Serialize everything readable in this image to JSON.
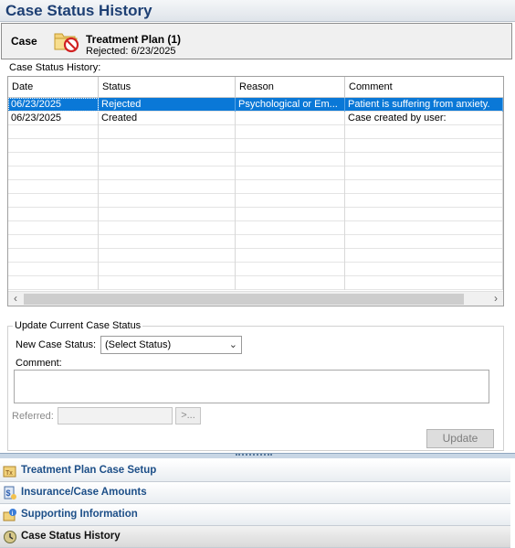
{
  "header": {
    "title": "Case Status History"
  },
  "case": {
    "label": "Case",
    "icon": "folder-rejected-icon",
    "plan_name": "Treatment Plan (1)",
    "plan_status": "Rejected: 6/23/2025"
  },
  "history": {
    "label": "Case Status History:",
    "columns": [
      "Date",
      "Status",
      "Reason",
      "Comment"
    ],
    "rows": [
      {
        "date": "06/23/2025",
        "status": "Rejected",
        "reason": "Psychological or Em...",
        "comment": "Patient is suffering from anxiety.",
        "selected": true
      },
      {
        "date": "06/23/2025",
        "status": "Created",
        "reason": "",
        "comment": "Case created by user:",
        "selected": false
      }
    ]
  },
  "update": {
    "group_label": "Update Current Case Status",
    "new_status_label": "New Case Status:",
    "status_value": "(Select Status)",
    "comment_label": "Comment:",
    "comment_value": "",
    "referred_label": "Referred:",
    "referred_value": "",
    "browse_label": ">...",
    "update_label": "Update"
  },
  "nav": {
    "items": [
      {
        "label": "Treatment Plan Case Setup",
        "icon": "treatment-plan-icon"
      },
      {
        "label": "Insurance/Case Amounts",
        "icon": "insurance-icon"
      },
      {
        "label": "Supporting Information",
        "icon": "supporting-info-icon"
      },
      {
        "label": "Case Status History",
        "icon": "case-history-icon"
      }
    ]
  },
  "colors": {
    "title": "#1d3f73",
    "selection": "#0a78d7",
    "nav_text": "#1d4f88"
  }
}
